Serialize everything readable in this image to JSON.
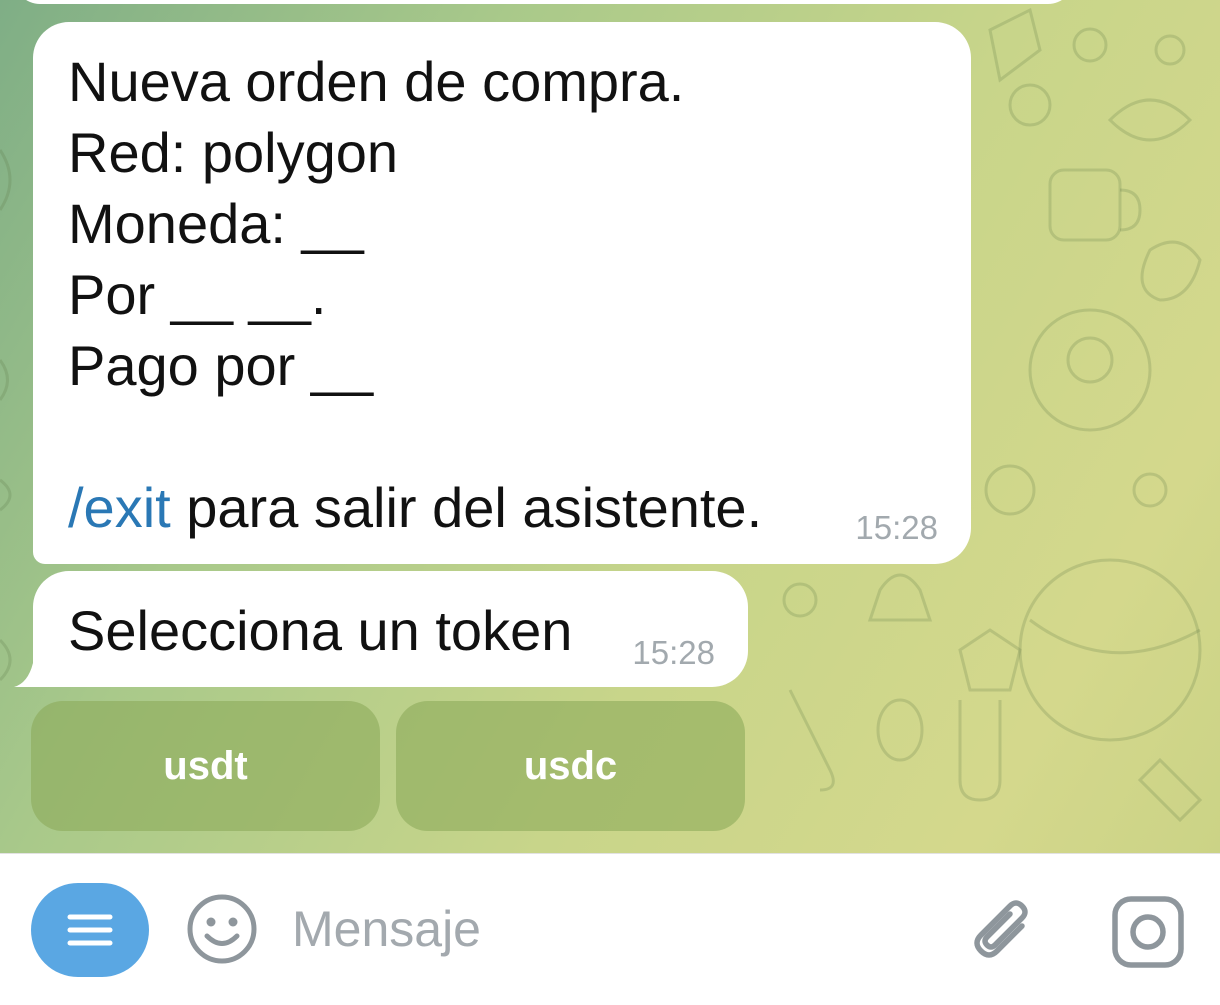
{
  "chat": {
    "messages": [
      {
        "lines": [
          "Nueva orden de compra.",
          "Red: polygon",
          "Moneda: __",
          "Por __ __.",
          "Pago por __",
          ""
        ],
        "command": "/exit",
        "command_suffix": " para salir del asistente.",
        "time": "15:28"
      },
      {
        "text": "Selecciona un token",
        "time": "15:28"
      }
    ],
    "keyboard": [
      {
        "label": "usdt"
      },
      {
        "label": "usdc"
      }
    ]
  },
  "input_bar": {
    "placeholder": "Mensaje",
    "icons": {
      "menu": "menu-icon",
      "emoji": "emoji-icon",
      "attach": "paperclip-icon",
      "camera": "camera-icon"
    }
  },
  "colors": {
    "link": "#2a78b5",
    "menu_button": "#5aa7e3",
    "keyboard_button": "#8caa5a",
    "timestamp": "#a2a9ae"
  }
}
